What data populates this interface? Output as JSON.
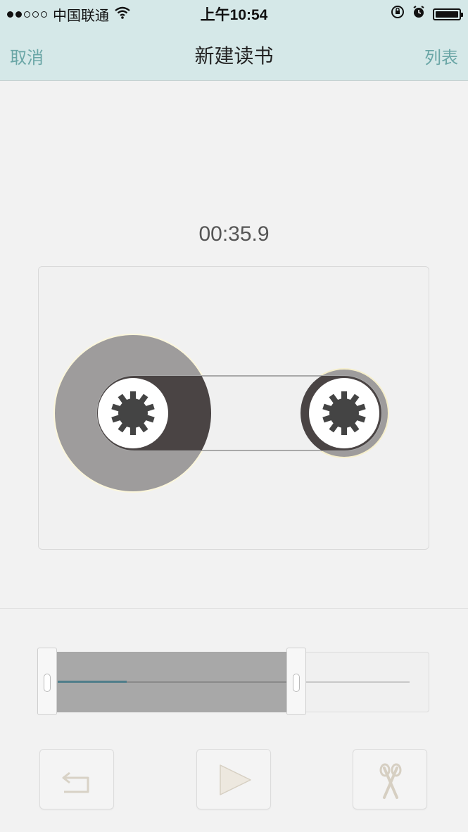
{
  "status_bar": {
    "carrier": "中国联通",
    "time": "上午10:54",
    "signal_bars_filled": 2,
    "signal_bars_total": 5,
    "icons": [
      "wifi-icon",
      "orientation-lock-icon",
      "alarm-icon",
      "battery-icon"
    ]
  },
  "nav": {
    "cancel_label": "取消",
    "title": "新建读书",
    "list_label": "列表"
  },
  "recorder": {
    "elapsed_time": "00:35.9"
  },
  "trimmer": {
    "playback_progress_percent": 30
  },
  "controls": {
    "buttons": [
      "undo-icon",
      "play-icon",
      "scissors-icon"
    ]
  },
  "colors": {
    "header_bg": "#d5e8e8",
    "nav_accent": "#6aa6a6",
    "progress": "#4f7d8a",
    "reel_dark": "#4a4444"
  }
}
